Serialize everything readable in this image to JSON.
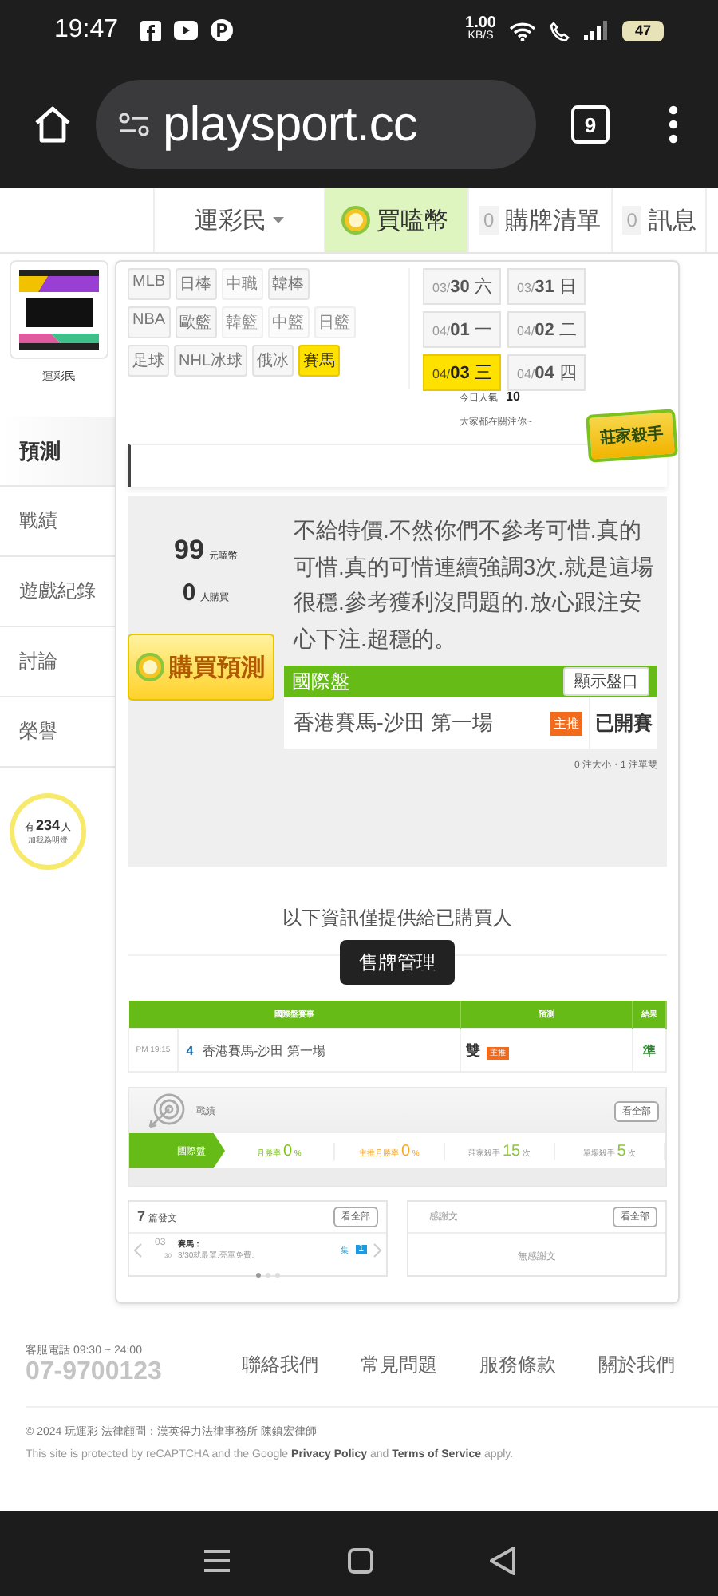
{
  "status_bar": {
    "time": "19:47",
    "speed": "1.00",
    "speed_unit": "KB/S",
    "battery": "47"
  },
  "browser": {
    "url": "playsport.cc",
    "tab_count": "9"
  },
  "top_nav": [
    {
      "kind": "dropdown",
      "label": "運彩民",
      "selected": false
    },
    {
      "kind": "coin",
      "label": "買嗑幣",
      "selected": true
    },
    {
      "kind": "count",
      "count": "0",
      "label": "購牌清單",
      "selected": false
    },
    {
      "kind": "count",
      "count": "0",
      "label": "訊息",
      "selected": false
    }
  ],
  "profile": {
    "name": "運彩民"
  },
  "side_menu": [
    {
      "label": "預測",
      "selected": true
    },
    {
      "label": "戰績",
      "selected": false
    },
    {
      "label": "遊戲紀錄",
      "selected": false
    },
    {
      "label": "討論",
      "selected": false
    },
    {
      "label": "榮譽",
      "selected": false
    }
  ],
  "fans": {
    "prefix": "有",
    "count": "234",
    "suffix": "人",
    "note": "加我為明燈"
  },
  "sports": [
    [
      {
        "label": "MLB",
        "disabled": false,
        "selected": false
      },
      {
        "label": "日棒",
        "disabled": false,
        "selected": false
      },
      {
        "label": "中職",
        "disabled": true,
        "selected": false
      },
      {
        "label": "韓棒",
        "disabled": false,
        "selected": false
      }
    ],
    [
      {
        "label": "NBA",
        "disabled": false,
        "selected": false
      },
      {
        "label": "歐籃",
        "disabled": false,
        "selected": false
      },
      {
        "label": "韓籃",
        "disabled": true,
        "selected": false
      },
      {
        "label": "中籃",
        "disabled": true,
        "selected": false
      },
      {
        "label": "日籃",
        "disabled": true,
        "selected": false
      }
    ],
    [
      {
        "label": "足球",
        "disabled": false,
        "selected": false
      },
      {
        "label": "NHL冰球",
        "disabled": false,
        "selected": false
      },
      {
        "label": "俄冰",
        "disabled": false,
        "selected": false
      },
      {
        "label": "賽馬",
        "disabled": false,
        "selected": true
      }
    ]
  ],
  "dates": [
    {
      "month": "03/",
      "day": "30",
      "weekday": "六",
      "selected": false
    },
    {
      "month": "03/",
      "day": "31",
      "weekday": "日",
      "selected": false
    },
    {
      "month": "04/",
      "day": "01",
      "weekday": "一",
      "selected": false
    },
    {
      "month": "04/",
      "day": "02",
      "weekday": "二",
      "selected": false
    },
    {
      "month": "04/",
      "day": "03",
      "weekday": "三",
      "selected": true
    },
    {
      "month": "04/",
      "day": "04",
      "weekday": "四",
      "selected": false
    }
  ],
  "popularity": {
    "label": "今日人氣",
    "value": "10",
    "note": "大家都在關注你~"
  },
  "badge": {
    "title": "莊家殺手"
  },
  "offer": {
    "price": "99",
    "price_unit": "元嗑幣",
    "buyers": "0",
    "buyers_unit": "人購買",
    "buy_button": "購買預測",
    "description": "不給特價.不然你們不參考可惜.真的可惜.真的可惜連續強調3次.就是這場很穩.參考獲利沒問題的.放心跟注安心下注.超穩的。",
    "market": {
      "title": "國際盤",
      "toggle": "顯示盤口",
      "game": "香港賽馬-沙田 第一場",
      "tag": "主推",
      "status": "已開賽"
    },
    "summary": "0 注大小・1 注單雙"
  },
  "notice": "以下資訊僅提供給已購買人",
  "manage_button": "售牌管理",
  "table": {
    "columns": [
      "國際盤賽事",
      "預測",
      "結果"
    ],
    "rows": [
      {
        "time": "PM 19:15",
        "number": "4",
        "game": "香港賽馬-沙田 第一場",
        "pick": "雙",
        "tag": "主推",
        "result": "準"
      }
    ]
  },
  "record": {
    "title": "戰績",
    "button": "看全部",
    "tab": "國際盤",
    "stats": [
      {
        "label": "月勝率",
        "value": "0",
        "unit": "%",
        "color": "#7cc21b"
      },
      {
        "label": "主推月勝率",
        "value": "0",
        "unit": "%",
        "color": "#f5a623"
      },
      {
        "label": "莊家殺手",
        "value": "15",
        "unit": "次",
        "color": "#8cc63f"
      },
      {
        "label": "單場殺手",
        "value": "5",
        "unit": "次",
        "color": "#8cc63f"
      }
    ]
  },
  "posts": {
    "count": "7",
    "title": "篇發文",
    "button": "看全部",
    "item": {
      "month": "03",
      "day": "30",
      "category": "賽馬：",
      "text": "3/30就最罩.亮單免費。",
      "badge_label": "集",
      "badge": "1"
    }
  },
  "thanks": {
    "title": "感謝文",
    "button": "看全部",
    "empty": "無感謝文"
  },
  "footer": {
    "phone_label": "客服電話 09:30 ~ 24:00",
    "phone": "07-9700123",
    "links": [
      "聯絡我們",
      "常見問題",
      "服務條款",
      "關於我們"
    ],
    "copyright": "© 2024 玩運彩 法律顧問：漢英得力法律事務所 陳鎮宏律師",
    "recaptcha": "This site is protected by reCAPTCHA and the Google **Privacy Policy** and **Terms of Service** apply."
  }
}
